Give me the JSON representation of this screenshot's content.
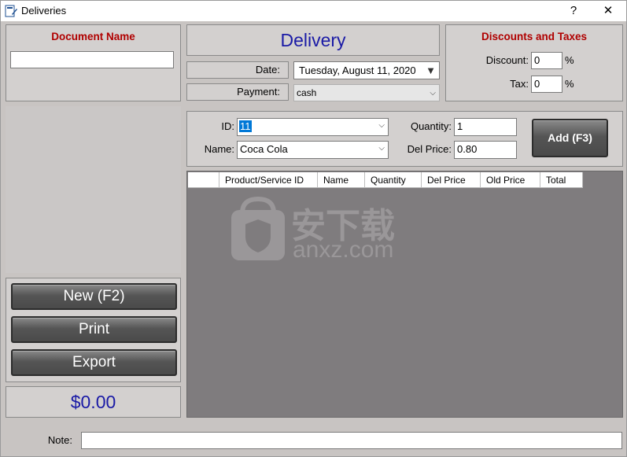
{
  "window": {
    "title": "Deliveries",
    "help_label": "?",
    "close_label": "✕",
    "icon": "document-edit-icon"
  },
  "document": {
    "heading": "Document Name",
    "value": ""
  },
  "delivery": {
    "title": "Delivery",
    "date_label": "Date:",
    "date_value": "Tuesday, August 11, 2020",
    "payment_label": "Payment:",
    "payment_value": "cash"
  },
  "discounts": {
    "heading": "Discounts and Taxes",
    "discount_label": "Discount:",
    "discount_value": "0",
    "discount_unit": "%",
    "tax_label": "Tax:",
    "tax_value": "0",
    "tax_unit": "%"
  },
  "item": {
    "id_label": "ID:",
    "id_value": "11",
    "name_label": "Name:",
    "name_value": "Coca Cola",
    "quantity_label": "Quantity:",
    "quantity_value": "1",
    "del_price_label": "Del Price:",
    "del_price_value": "0.80",
    "add_label": "Add (F3)"
  },
  "grid": {
    "columns": [
      "",
      "Product/Service ID",
      "Name",
      "Quantity",
      "Del Price",
      "Old Price",
      "Total"
    ],
    "rows": []
  },
  "actions": {
    "new_label": "New (F2)",
    "print_label": "Print",
    "export_label": "Export"
  },
  "total": {
    "value": "$0.00",
    "color": "#1a1aa6"
  },
  "note": {
    "label": "Note:",
    "value": ""
  },
  "watermark": {
    "text_cn": "安下载",
    "text_en": "anxz.com"
  },
  "colors": {
    "accent_red": "#b00000",
    "title_blue": "#1a1aa6"
  }
}
